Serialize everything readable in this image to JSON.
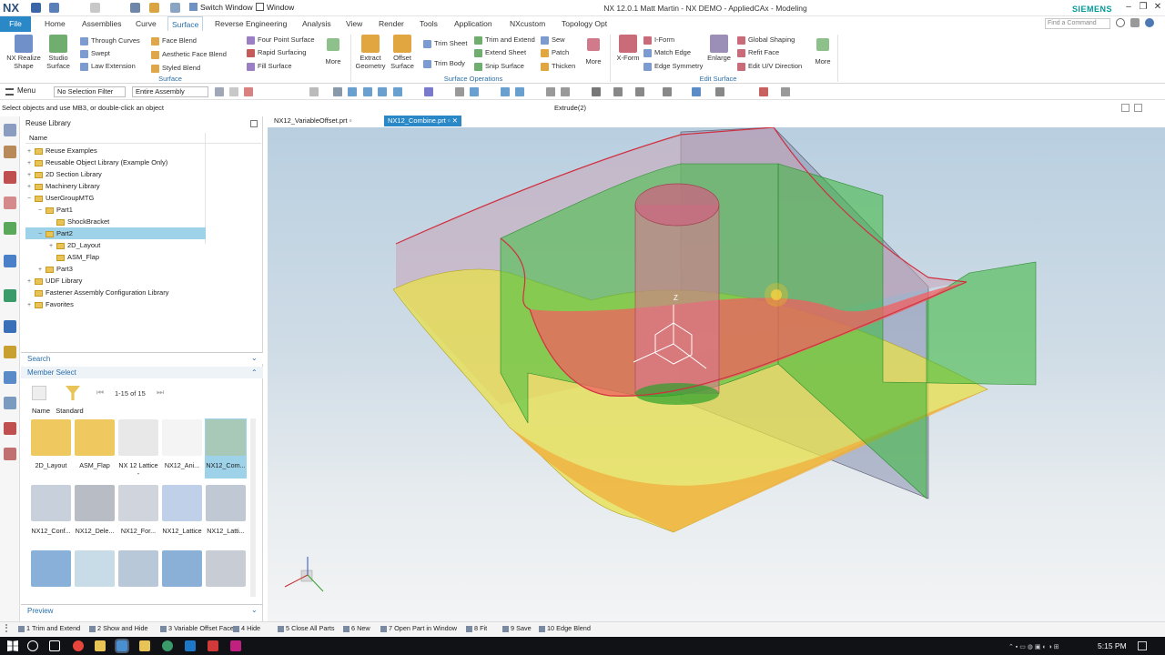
{
  "app": {
    "logo": "NX",
    "window_title": "NX 12.0.1 Matt Martin - NX DEMO - AppliedCAx - Modeling",
    "switch_window": "Switch Window",
    "window_menu": "Window",
    "brand": "SIEMENS",
    "search_placeholder": "Find a Command"
  },
  "menu_tabs": [
    "File",
    "Home",
    "Assemblies",
    "Curve",
    "Surface",
    "Reverse Engineering",
    "Analysis",
    "View",
    "Render",
    "Tools",
    "Application",
    "NXcustom",
    "Topology Opt"
  ],
  "ribbon": {
    "surface_group": {
      "big": [
        "NX Realize Shape",
        "Studio Surface"
      ],
      "small_col1": [
        "Through Curves",
        "Swept",
        "Law Extension"
      ],
      "small_col2": [
        "Face Blend",
        "Aesthetic Face Blend",
        "Styled Blend"
      ],
      "small_col3": [
        "Four Point Surface",
        "Rapid Surfacing",
        "Fill Surface"
      ],
      "more": "More",
      "label": "Surface"
    },
    "ops_group": {
      "big": [
        "Extract Geometry",
        "Offset Surface"
      ],
      "small_col1": [
        "Trim Sheet",
        "Trim Body"
      ],
      "small_col2": [
        "Trim and Extend",
        "Extend Sheet",
        "Snip Surface"
      ],
      "small_col3": [
        "Sew",
        "Patch",
        "Thicken"
      ],
      "more": "More",
      "label": "Surface Operations"
    },
    "edit_group": {
      "big": [
        "X-Form",
        "Enlarge"
      ],
      "small_col1": [
        "I-Form",
        "Match Edge",
        "Edge Symmetry"
      ],
      "small_col2": [
        "Global Shaping",
        "Refit Face",
        "Edit U/V Direction"
      ],
      "more": "More",
      "label": "Edit Surface"
    }
  },
  "toolbar": {
    "menu": "Menu",
    "filter": "No Selection Filter",
    "scope": "Entire Assembly"
  },
  "status": {
    "prompt": "Select objects and use MB3, or double-click an object",
    "feature": "Extrude(2)"
  },
  "navigator": {
    "title": "Reuse Library",
    "column": "Name",
    "tree": [
      {
        "label": "Reuse Examples",
        "indent": 0,
        "exp": "+"
      },
      {
        "label": "Reusable Object Library (Example Only)",
        "indent": 0,
        "exp": "+"
      },
      {
        "label": "2D Section Library",
        "indent": 0,
        "exp": "+"
      },
      {
        "label": "Machinery Library",
        "indent": 0,
        "exp": "+"
      },
      {
        "label": "UserGroupMTG",
        "indent": 0,
        "exp": "−"
      },
      {
        "label": "Part1",
        "indent": 1,
        "exp": "−"
      },
      {
        "label": "ShockBracket",
        "indent": 2,
        "exp": ""
      },
      {
        "label": "Part2",
        "indent": 1,
        "exp": "−"
      },
      {
        "label": "2D_Layout",
        "indent": 2,
        "exp": "+"
      },
      {
        "label": "ASM_Flap",
        "indent": 2,
        "exp": ""
      },
      {
        "label": "Part3",
        "indent": 1,
        "exp": "+"
      },
      {
        "label": "UDF Library",
        "indent": 0,
        "exp": "+"
      },
      {
        "label": "Fastener Assembly Configuration Library",
        "indent": 0,
        "exp": ""
      },
      {
        "label": "Favorites",
        "indent": 0,
        "exp": "+"
      }
    ],
    "search_label": "Search",
    "member_select_label": "Member Select",
    "pager": "1-15 of 15",
    "col_name": "Name",
    "col_standard": "Standard",
    "members": [
      "2D_Layout",
      "ASM_Flap",
      "NX 12 Lattice -",
      "NX12_Ani...",
      "NX12_Com...",
      "NX12_Conf...",
      "NX12_Dele...",
      "NX12_For...",
      "NX12_Lattice",
      "NX12_Latti...",
      "",
      "",
      "",
      "",
      ""
    ],
    "preview_label": "Preview"
  },
  "doc_tabs": [
    "NX12_VariableOffset.prt",
    "NX12_Combine.prt"
  ],
  "axis_label": "Z",
  "bottom_bar": [
    "1 Trim and Extend",
    "2 Show and Hide",
    "3 Variable Offset Face",
    "4 Hide",
    "5 Close All Parts",
    "6 New",
    "7 Open Part in Window",
    "8 Fit",
    "9 Save",
    "10 Edge Blend"
  ],
  "clock": "5:15 PM",
  "colors": {
    "accent": "#2a88c7",
    "selection": "#9ed2e8",
    "brand": "#009999"
  }
}
